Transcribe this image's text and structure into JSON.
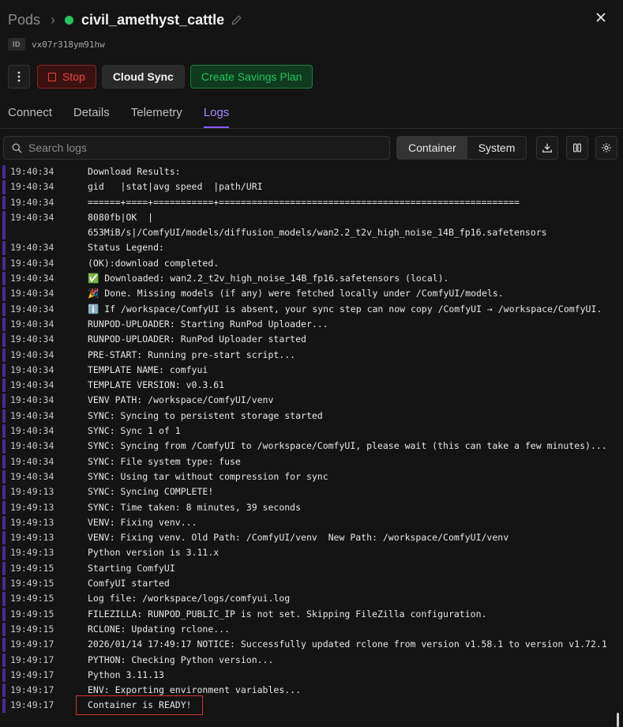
{
  "header": {
    "breadcrumb_root": "Pods",
    "pod_name": "civil_amethyst_cattle",
    "id_label": "ID",
    "id_value": "vx07r318ym91hw"
  },
  "actions": {
    "stop_label": "Stop",
    "cloud_sync_label": "Cloud Sync",
    "savings_plan_label": "Create Savings Plan"
  },
  "tabs": [
    {
      "label": "Connect"
    },
    {
      "label": "Details"
    },
    {
      "label": "Telemetry"
    },
    {
      "label": "Logs"
    }
  ],
  "active_tab": "Logs",
  "toolbar": {
    "search_placeholder": "Search logs",
    "segment_container": "Container",
    "segment_system": "System",
    "active_segment": "Container"
  },
  "colors": {
    "accent": "#8b5cf6",
    "status_running": "#22c55e",
    "stop": "#ef4444",
    "highlight_box": "#d13434"
  },
  "logs": [
    {
      "time": "19:40:34",
      "text": "Download Results:"
    },
    {
      "time": "19:40:34",
      "text": "gid   |stat|avg speed  |path/URI"
    },
    {
      "time": "19:40:34",
      "text": "======+====+===========+======================================================="
    },
    {
      "time": "19:40:34",
      "text": "8080fb|OK  |",
      "text2": "653MiB/s|/ComfyUI/models/diffusion_models/wan2.2_t2v_high_noise_14B_fp16.safetensors"
    },
    {
      "time": "19:40:34",
      "text": "Status Legend:"
    },
    {
      "time": "19:40:34",
      "text": "(OK):download completed."
    },
    {
      "time": "19:40:34",
      "text": "✅ Downloaded: wan2.2_t2v_high_noise_14B_fp16.safetensors (local)."
    },
    {
      "time": "19:40:34",
      "text": "🎉 Done. Missing models (if any) were fetched locally under /ComfyUI/models."
    },
    {
      "time": "19:40:34",
      "text": "ℹ️ If /workspace/ComfyUI is absent, your sync step can now copy /ComfyUI → /workspace/ComfyUI."
    },
    {
      "time": "19:40:34",
      "text": "RUNPOD-UPLOADER: Starting RunPod Uploader..."
    },
    {
      "time": "19:40:34",
      "text": "RUNPOD-UPLOADER: RunPod Uploader started"
    },
    {
      "time": "19:40:34",
      "text": "PRE-START: Running pre-start script..."
    },
    {
      "time": "19:40:34",
      "text": "TEMPLATE NAME: comfyui"
    },
    {
      "time": "19:40:34",
      "text": "TEMPLATE VERSION: v0.3.61"
    },
    {
      "time": "19:40:34",
      "text": "VENV PATH: /workspace/ComfyUI/venv"
    },
    {
      "time": "19:40:34",
      "text": "SYNC: Syncing to persistent storage started"
    },
    {
      "time": "19:40:34",
      "text": "SYNC: Sync 1 of 1"
    },
    {
      "time": "19:40:34",
      "text": "SYNC: Syncing from /ComfyUI to /workspace/ComfyUI, please wait (this can take a few minutes)..."
    },
    {
      "time": "19:40:34",
      "text": "SYNC: File system type: fuse"
    },
    {
      "time": "19:40:34",
      "text": "SYNC: Using tar without compression for sync"
    },
    {
      "time": "19:49:13",
      "text": "SYNC: Syncing COMPLETE!"
    },
    {
      "time": "19:49:13",
      "text": "SYNC: Time taken: 8 minutes, 39 seconds"
    },
    {
      "time": "19:49:13",
      "text": "VENV: Fixing venv..."
    },
    {
      "time": "19:49:13",
      "text": "VENV: Fixing venv. Old Path: /ComfyUI/venv  New Path: /workspace/ComfyUI/venv"
    },
    {
      "time": "19:49:13",
      "text": "Python version is 3.11.x"
    },
    {
      "time": "19:49:15",
      "text": "Starting ComfyUI"
    },
    {
      "time": "19:49:15",
      "text": "ComfyUI started"
    },
    {
      "time": "19:49:15",
      "text": "Log file: /workspace/logs/comfyui.log"
    },
    {
      "time": "19:49:15",
      "text": "FILEZILLA: RUNPOD_PUBLIC_IP is not set. Skipping FileZilla configuration."
    },
    {
      "time": "19:49:15",
      "text": "RCLONE: Updating rclone..."
    },
    {
      "time": "19:49:17",
      "text": "2026/01/14 17:49:17 NOTICE: Successfully updated rclone from version v1.58.1 to version v1.72.1"
    },
    {
      "time": "19:49:17",
      "text": "PYTHON: Checking Python version..."
    },
    {
      "time": "19:49:17",
      "text": "Python 3.11.13"
    },
    {
      "time": "19:49:17",
      "text": "ENV: Exporting environment variables..."
    },
    {
      "time": "19:49:17",
      "text": "Container is READY!"
    }
  ]
}
